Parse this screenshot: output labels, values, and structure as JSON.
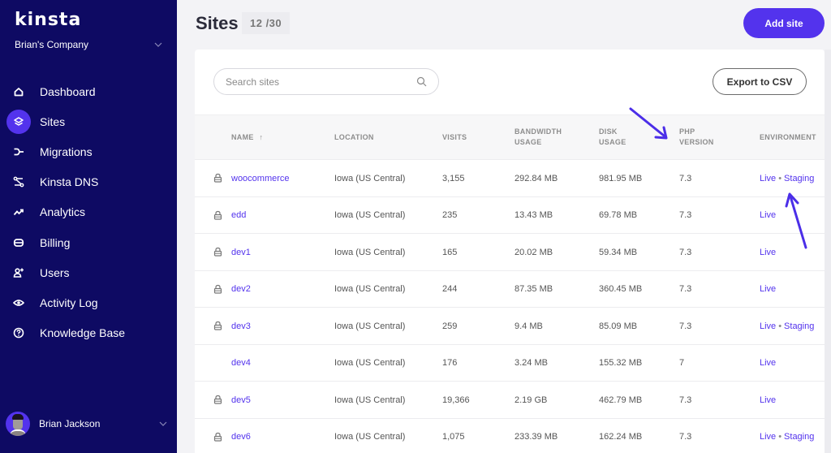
{
  "brand": {
    "logo": "kinsta",
    "accent_color": "#5333ed",
    "sidebar_color": "#0e0a63"
  },
  "company": {
    "name": "Brian's Company"
  },
  "sidebar": {
    "items": [
      {
        "label": "Dashboard",
        "icon": "home-icon",
        "active": false
      },
      {
        "label": "Sites",
        "icon": "layers-icon",
        "active": true
      },
      {
        "label": "Migrations",
        "icon": "migrations-icon",
        "active": false
      },
      {
        "label": "Kinsta DNS",
        "icon": "dns-icon",
        "active": false
      },
      {
        "label": "Analytics",
        "icon": "analytics-icon",
        "active": false
      },
      {
        "label": "Billing",
        "icon": "billing-icon",
        "active": false
      },
      {
        "label": "Users",
        "icon": "add-user-icon",
        "active": false
      },
      {
        "label": "Activity Log",
        "icon": "eye-icon",
        "active": false
      },
      {
        "label": "Knowledge Base",
        "icon": "help-icon",
        "active": false
      }
    ]
  },
  "user": {
    "name": "Brian Jackson"
  },
  "header": {
    "title": "Sites",
    "count": "12 /30",
    "add_site_label": "Add site"
  },
  "toolbar": {
    "search_placeholder": "Search sites",
    "search_value": "",
    "export_label": "Export to CSV"
  },
  "table": {
    "columns": {
      "name": "NAME",
      "name_sort": "↑",
      "location": "LOCATION",
      "visits": "VISITS",
      "bandwidth_1": "BANDWIDTH",
      "bandwidth_2": "USAGE",
      "disk_1": "DISK",
      "disk_2": "USAGE",
      "php_1": "PHP",
      "php_2": "VERSION",
      "environment": "ENVIRONMENT"
    },
    "env_separator": "•",
    "rows": [
      {
        "locked": true,
        "name": "woocommerce",
        "location": "Iowa (US Central)",
        "visits": "3,155",
        "bandwidth": "292.84 MB",
        "disk": "981.95 MB",
        "php": "7.3",
        "env_live": "Live",
        "env_staging": "Staging"
      },
      {
        "locked": true,
        "name": "edd",
        "location": "Iowa (US Central)",
        "visits": "235",
        "bandwidth": "13.43 MB",
        "disk": "69.78 MB",
        "php": "7.3",
        "env_live": "Live",
        "env_staging": null
      },
      {
        "locked": true,
        "name": "dev1",
        "location": "Iowa (US Central)",
        "visits": "165",
        "bandwidth": "20.02 MB",
        "disk": "59.34 MB",
        "php": "7.3",
        "env_live": "Live",
        "env_staging": null
      },
      {
        "locked": true,
        "name": "dev2",
        "location": "Iowa (US Central)",
        "visits": "244",
        "bandwidth": "87.35 MB",
        "disk": "360.45 MB",
        "php": "7.3",
        "env_live": "Live",
        "env_staging": null
      },
      {
        "locked": true,
        "name": "dev3",
        "location": "Iowa (US Central)",
        "visits": "259",
        "bandwidth": "9.4 MB",
        "disk": "85.09 MB",
        "php": "7.3",
        "env_live": "Live",
        "env_staging": "Staging"
      },
      {
        "locked": false,
        "name": "dev4",
        "location": "Iowa (US Central)",
        "visits": "176",
        "bandwidth": "3.24 MB",
        "disk": "155.32 MB",
        "php": "7",
        "env_live": "Live",
        "env_staging": null
      },
      {
        "locked": true,
        "name": "dev5",
        "location": "Iowa (US Central)",
        "visits": "19,366",
        "bandwidth": "2.19 GB",
        "disk": "462.79 MB",
        "php": "7.3",
        "env_live": "Live",
        "env_staging": null
      },
      {
        "locked": true,
        "name": "dev6",
        "location": "Iowa (US Central)",
        "visits": "1,075",
        "bandwidth": "233.39 MB",
        "disk": "162.24 MB",
        "php": "7.3",
        "env_live": "Live",
        "env_staging": "Staging"
      }
    ]
  },
  "annotations": [
    {
      "type": "arrow",
      "target": "php-version-header"
    },
    {
      "type": "arrow",
      "target": "staging-link"
    }
  ]
}
